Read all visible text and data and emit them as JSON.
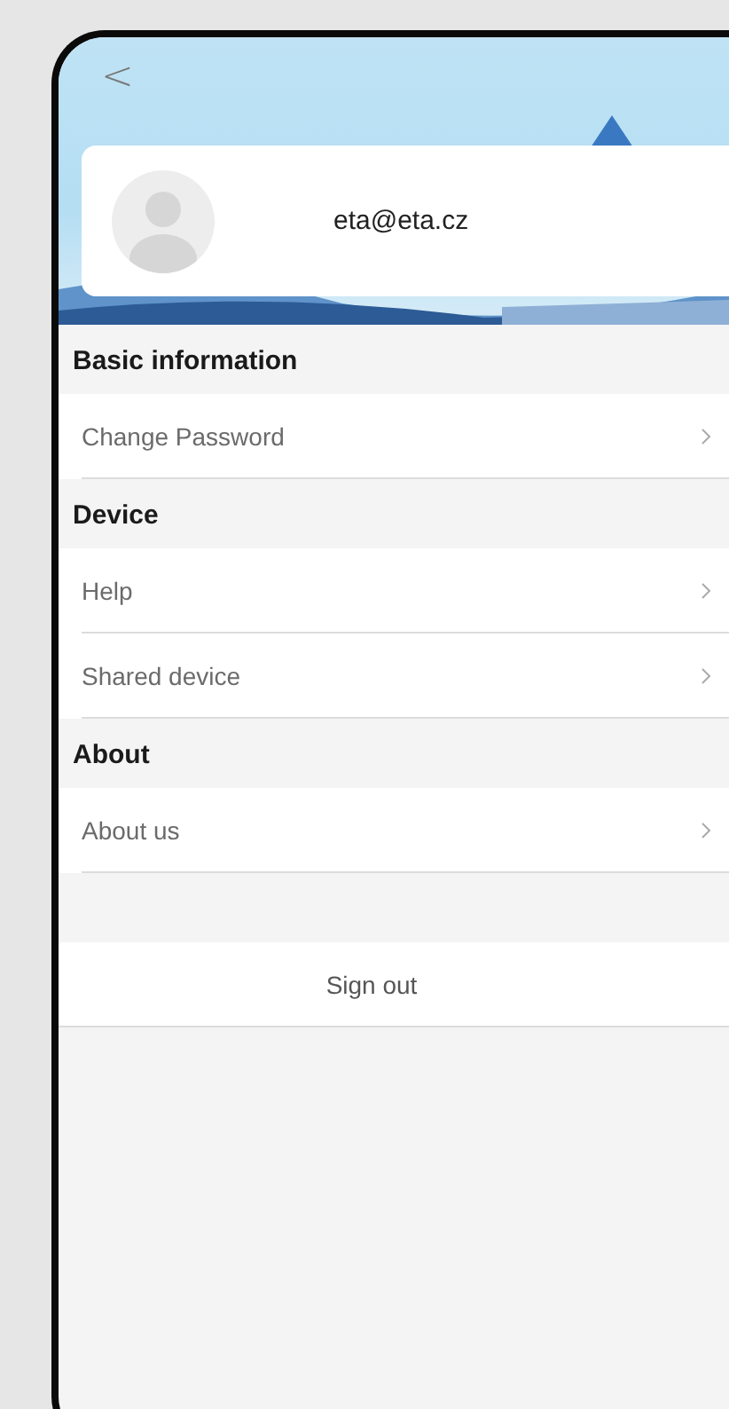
{
  "header": {
    "back": "<"
  },
  "profile": {
    "email": "eta@eta.cz"
  },
  "sections": [
    {
      "title": "Basic information",
      "items": [
        {
          "label": "Change Password"
        }
      ]
    },
    {
      "title": "Device",
      "items": [
        {
          "label": "Help"
        },
        {
          "label": "Shared device"
        }
      ]
    },
    {
      "title": "About",
      "items": [
        {
          "label": "About us"
        }
      ]
    }
  ],
  "sign_out": "Sign out"
}
